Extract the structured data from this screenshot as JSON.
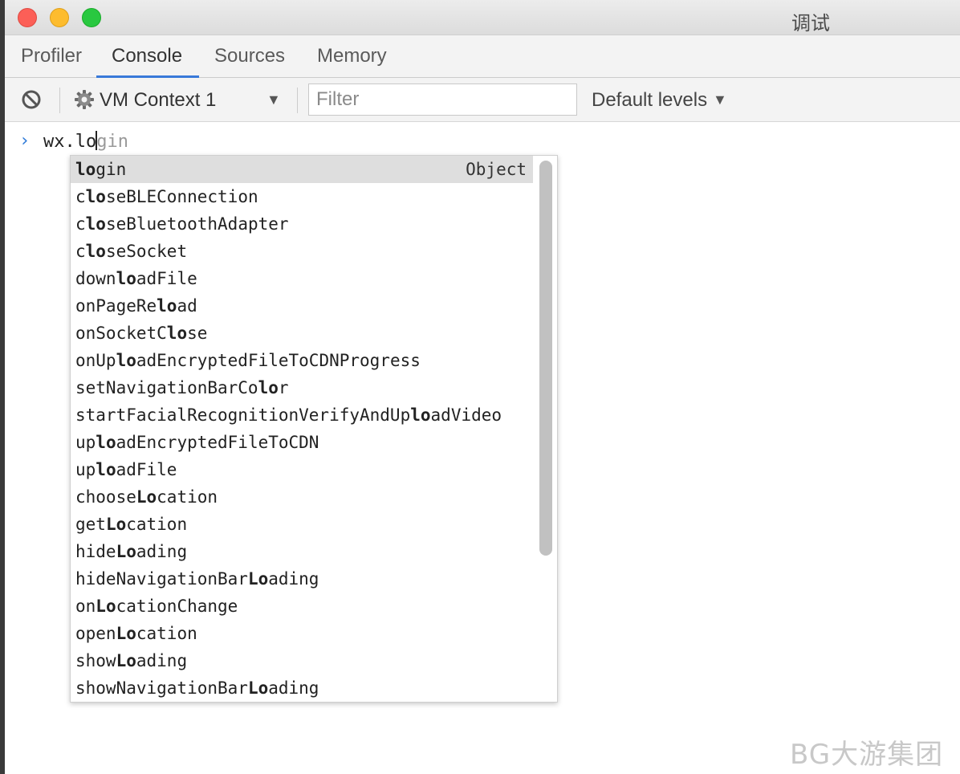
{
  "window": {
    "title": "调试"
  },
  "tabs": [
    {
      "label": "Profiler"
    },
    {
      "label": "Console",
      "active": true
    },
    {
      "label": "Sources"
    },
    {
      "label": "Memory"
    }
  ],
  "toolbar": {
    "context": "VM Context 1",
    "filter_placeholder": "Filter",
    "levels": "Default levels"
  },
  "console": {
    "prompt": "›",
    "typed": "wx.lo",
    "ghost": "gin"
  },
  "autocomplete": {
    "selected_type": "Object",
    "items": [
      {
        "parts": [
          [
            "lo",
            true
          ],
          [
            "gin",
            false
          ]
        ],
        "selected": true
      },
      {
        "parts": [
          [
            "c",
            false
          ],
          [
            "lo",
            true
          ],
          [
            "seBLEConnection",
            false
          ]
        ]
      },
      {
        "parts": [
          [
            "c",
            false
          ],
          [
            "lo",
            true
          ],
          [
            "seBluetoothAdapter",
            false
          ]
        ]
      },
      {
        "parts": [
          [
            "c",
            false
          ],
          [
            "lo",
            true
          ],
          [
            "seSocket",
            false
          ]
        ]
      },
      {
        "parts": [
          [
            "down",
            false
          ],
          [
            "lo",
            true
          ],
          [
            "adFile",
            false
          ]
        ]
      },
      {
        "parts": [
          [
            "onPageRe",
            false
          ],
          [
            "lo",
            true
          ],
          [
            "ad",
            false
          ]
        ]
      },
      {
        "parts": [
          [
            "onSocketC",
            false
          ],
          [
            "lo",
            true
          ],
          [
            "se",
            false
          ]
        ]
      },
      {
        "parts": [
          [
            "onUp",
            false
          ],
          [
            "lo",
            true
          ],
          [
            "adEncryptedFileToCDNProgress",
            false
          ]
        ]
      },
      {
        "parts": [
          [
            "setNavigationBarCo",
            false
          ],
          [
            "lo",
            true
          ],
          [
            "r",
            false
          ]
        ]
      },
      {
        "parts": [
          [
            "startFacialRecognitionVerifyAndUp",
            false
          ],
          [
            "lo",
            true
          ],
          [
            "adVideo",
            false
          ]
        ]
      },
      {
        "parts": [
          [
            "up",
            false
          ],
          [
            "lo",
            true
          ],
          [
            "adEncryptedFileToCDN",
            false
          ]
        ]
      },
      {
        "parts": [
          [
            "up",
            false
          ],
          [
            "lo",
            true
          ],
          [
            "adFile",
            false
          ]
        ]
      },
      {
        "parts": [
          [
            "choose",
            false
          ],
          [
            "Lo",
            true
          ],
          [
            "cation",
            false
          ]
        ]
      },
      {
        "parts": [
          [
            "get",
            false
          ],
          [
            "Lo",
            true
          ],
          [
            "cation",
            false
          ]
        ]
      },
      {
        "parts": [
          [
            "hide",
            false
          ],
          [
            "Lo",
            true
          ],
          [
            "ading",
            false
          ]
        ]
      },
      {
        "parts": [
          [
            "hideNavigationBar",
            false
          ],
          [
            "Lo",
            true
          ],
          [
            "ading",
            false
          ]
        ]
      },
      {
        "parts": [
          [
            "on",
            false
          ],
          [
            "Lo",
            true
          ],
          [
            "cationChange",
            false
          ]
        ]
      },
      {
        "parts": [
          [
            "open",
            false
          ],
          [
            "Lo",
            true
          ],
          [
            "cation",
            false
          ]
        ]
      },
      {
        "parts": [
          [
            "show",
            false
          ],
          [
            "Lo",
            true
          ],
          [
            "ading",
            false
          ]
        ]
      },
      {
        "parts": [
          [
            "showNavigationBar",
            false
          ],
          [
            "Lo",
            true
          ],
          [
            "ading",
            false
          ]
        ]
      }
    ]
  },
  "watermark": "BG大游集团",
  "icons": {
    "clear": "block-icon",
    "context": "gear-icon",
    "dropdown": "triangle-down-icon",
    "prompt": "chevron-right-icon"
  },
  "colors": {
    "accent": "#3879d9",
    "close": "#fc5f57",
    "minimize": "#fdbc2e",
    "maximize": "#29c840"
  }
}
